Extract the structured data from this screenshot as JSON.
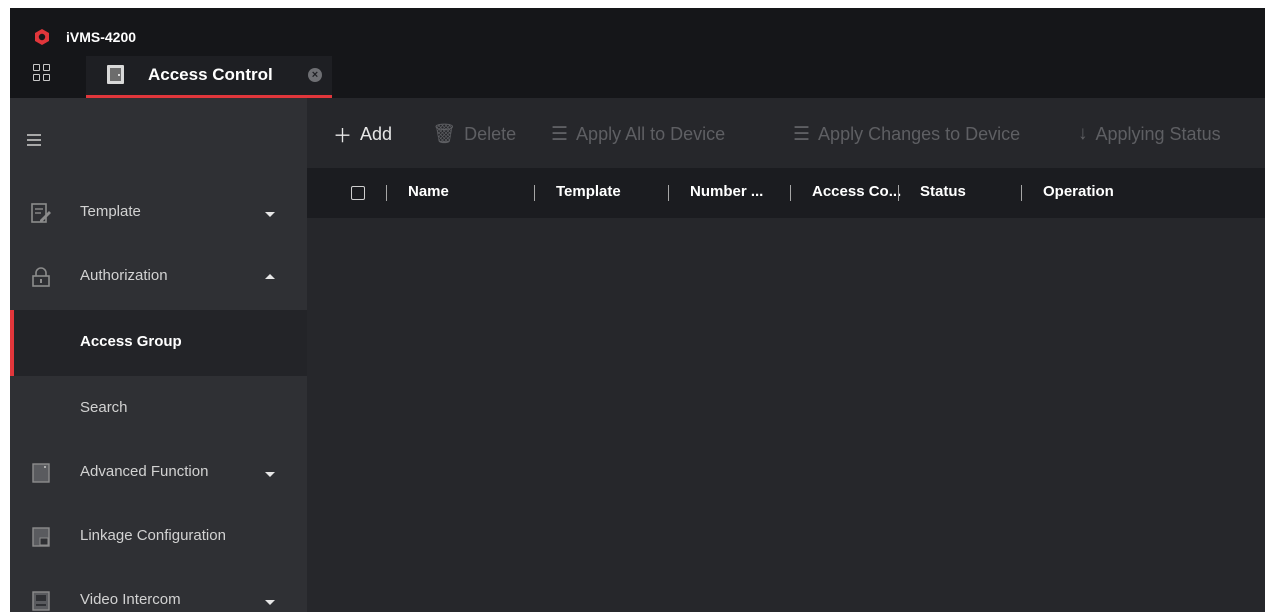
{
  "app": {
    "title": "iVMS-4200",
    "logo_color": "#e1363b",
    "accent_color": "#e1363b",
    "icon": "hikvision-logo"
  },
  "tabs": [
    {
      "label": "Access Control",
      "icon": "door-icon",
      "close_icon": "close-circle-icon",
      "active": true
    }
  ],
  "sidebar": {
    "menu_icon": "hamburger-icon",
    "items": [
      {
        "label": "Template",
        "icon": "edit-template-icon",
        "expanded": false
      },
      {
        "label": "Authorization",
        "icon": "lock-icon",
        "expanded": true,
        "children": [
          {
            "label": "Access Group",
            "active": true
          },
          {
            "label": "Search",
            "active": false
          }
        ]
      },
      {
        "label": "Advanced Function",
        "icon": "advanced-function-icon",
        "expanded": false
      },
      {
        "label": "Linkage Configuration",
        "icon": "linkage-icon"
      },
      {
        "label": "Video Intercom",
        "icon": "intercom-icon",
        "expanded": false
      }
    ]
  },
  "toolbar": {
    "add": {
      "label": "Add",
      "icon": "plus-icon",
      "enabled": true
    },
    "delete": {
      "label": "Delete",
      "icon": "trash-icon",
      "enabled": false
    },
    "apply_all": {
      "label": "Apply All to Device",
      "icon": "apply-all-icon",
      "enabled": false
    },
    "apply_changes": {
      "label": "Apply Changes to Device",
      "icon": "apply-changes-icon",
      "enabled": false
    },
    "applying_status": {
      "label": "Applying Status",
      "icon": "download-circle-icon",
      "enabled": false
    }
  },
  "table": {
    "columns": [
      "Name",
      "Template",
      "Number ...",
      "Access Co...",
      "Status",
      "Operation"
    ],
    "rows": []
  }
}
